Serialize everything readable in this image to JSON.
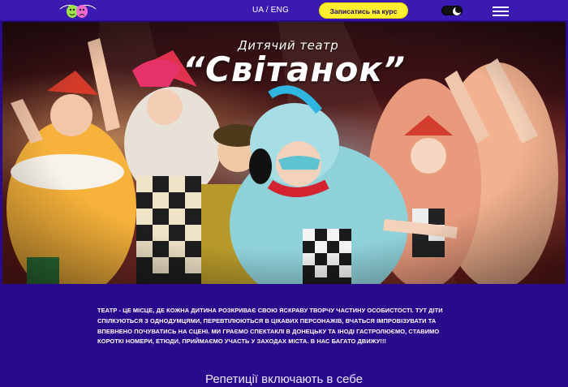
{
  "header": {
    "language_switch": "UA / ENG",
    "cta_label": "Записатись на курс",
    "icons": [
      "theatre-masks-logo",
      "dark-mode-toggle",
      "menu-icon"
    ]
  },
  "hero": {
    "subtitle": "Дитячий театр",
    "title": "“Світанок”"
  },
  "about": {
    "text": "Театр - це місце, де кожна дитина розкриває свою яскраву творчу частину особистості. Тут діти спілкуються з однодумцями, перевтілюються в цікавих персонажів, вчаться імпровізувати та впевнено почуватись на сцені. Ми граємо спектаклі в Донецьку та іноді гастролюємо, ставимо короткі номери, етюди, приймаємо участь у заходах міста. В нас багато движу!!!"
  },
  "section": {
    "title": "Репетиції включають в себе"
  },
  "colors": {
    "background": "#2a0a8c",
    "nav": "#3a1ab0",
    "cta": "#ffef2e"
  }
}
